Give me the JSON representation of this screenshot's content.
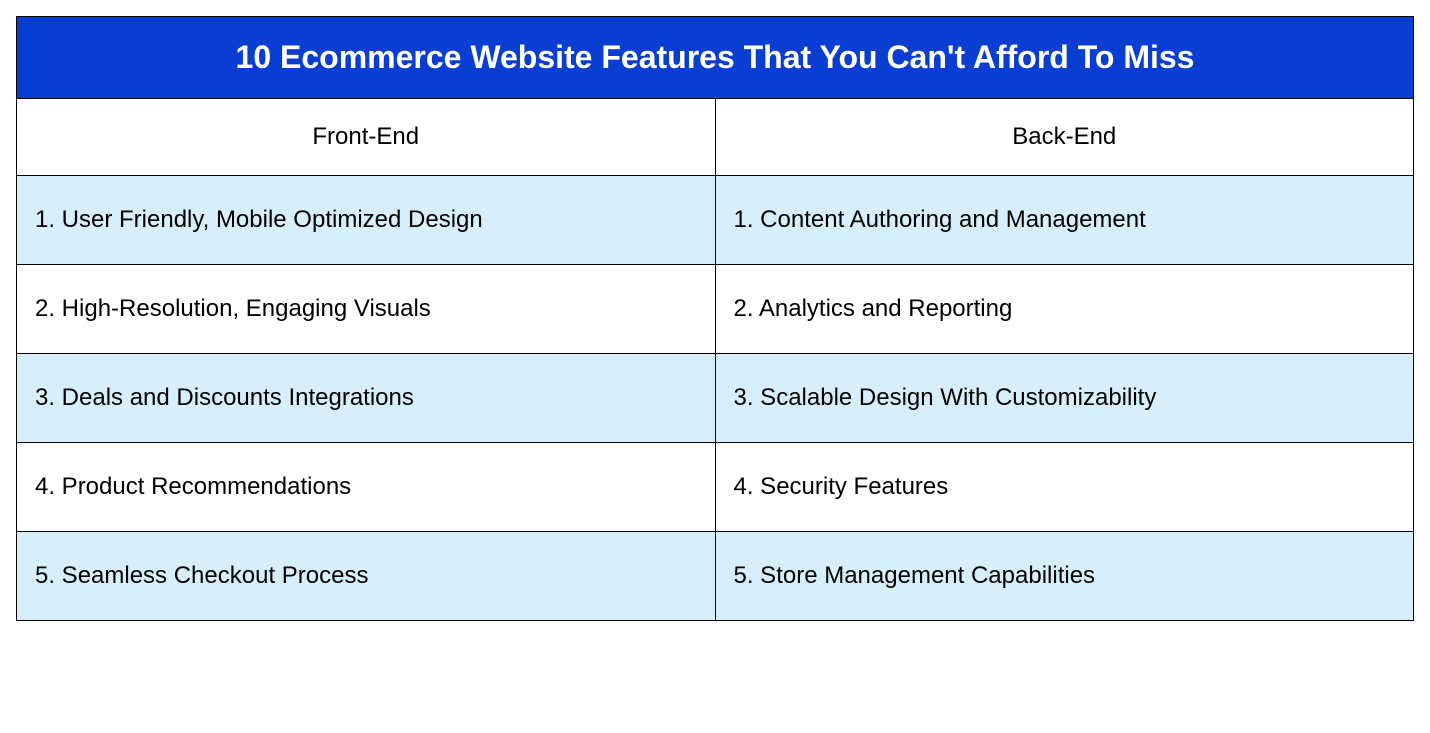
{
  "title": "10 Ecommerce Website Features That You Can't Afford To Miss",
  "columns": {
    "left": "Front-End",
    "right": "Back-End"
  },
  "rows": [
    {
      "left": "1. User Friendly, Mobile Optimized Design",
      "right": "1. Content Authoring and Management",
      "shaded": true
    },
    {
      "left": "2. High-Resolution, Engaging Visuals",
      "right": "2. Analytics and Reporting",
      "shaded": false
    },
    {
      "left": "3. Deals and Discounts Integrations",
      "right": "3. Scalable Design With Customizability",
      "shaded": true
    },
    {
      "left": "4. Product Recommendations",
      "right": "4. Security Features",
      "shaded": false
    },
    {
      "left": "5. Seamless Checkout Process",
      "right": "5. Store Management Capabilities",
      "shaded": true
    }
  ],
  "colors": {
    "titleBackground": "#0a3dd1",
    "titleText": "#ffffff",
    "shadedRow": "#d6effb",
    "border": "#000000"
  }
}
